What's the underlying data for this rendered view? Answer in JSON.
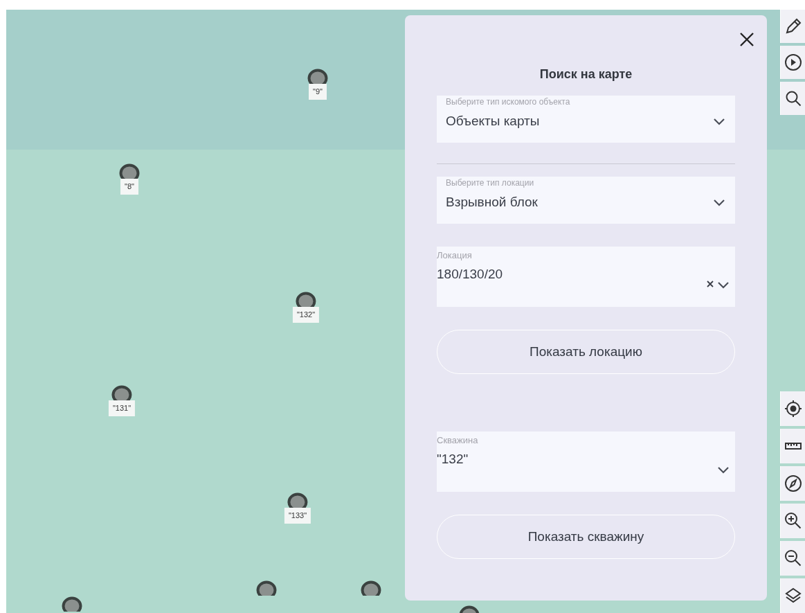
{
  "map": {
    "markers": [
      {
        "label": "\"9\""
      },
      {
        "label": "\"8\""
      },
      {
        "label": "\"132\""
      },
      {
        "label": "\"131\""
      },
      {
        "label": "\"133\""
      }
    ]
  },
  "panel": {
    "title": "Поиск на карте",
    "items": [
      {
        "kind": "select",
        "label": "Выберите тип искомого объекта",
        "value": "Объекты карты",
        "clearable": false
      },
      {
        "kind": "divider"
      },
      {
        "kind": "select",
        "label": "Выберите тип локации",
        "value": "Взрывной блок",
        "clearable": false
      },
      {
        "kind": "select",
        "label": "Локация",
        "value": "180/130/20",
        "clearable": true
      },
      {
        "kind": "button",
        "label": "Показать локацию"
      },
      {
        "kind": "select",
        "label": "Скважина",
        "value": "\"132\"",
        "clearable": false
      },
      {
        "kind": "button",
        "label": "Показать скважину"
      }
    ]
  },
  "toolbar": {
    "top": [
      {
        "kind": "pencil"
      },
      {
        "kind": "play"
      },
      {
        "kind": "search"
      }
    ],
    "bottom": [
      {
        "kind": "target"
      },
      {
        "kind": "ruler"
      },
      {
        "kind": "compass"
      },
      {
        "kind": "zoom-in"
      },
      {
        "kind": "zoom-out"
      },
      {
        "kind": "layers"
      }
    ]
  }
}
